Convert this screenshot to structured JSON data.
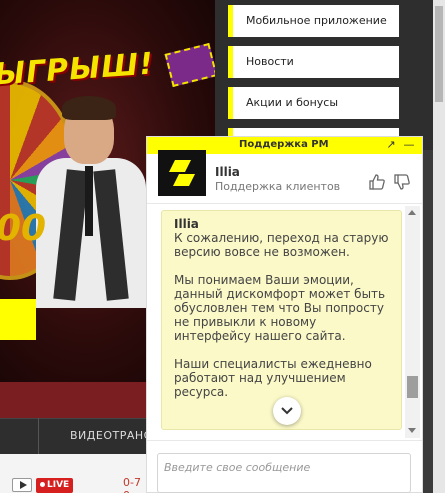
{
  "promo": {
    "headline": "ЫГРЫШ!",
    "neon_number": "00",
    "bottom_video_label": "ВИДЕОТРАНСЛ"
  },
  "match": {
    "live_badge": "LIVE",
    "score_a": "0-7",
    "score_b": "0"
  },
  "nav": {
    "items": [
      {
        "label": "Мобильное приложение"
      },
      {
        "label": "Новости"
      },
      {
        "label": "Акции и бонусы"
      }
    ]
  },
  "chat": {
    "title": "Поддержка РМ",
    "expand_glyph": "↗",
    "minimize_glyph": "—",
    "agent": {
      "name": "Illia",
      "role": "Поддержка клиентов"
    },
    "message": {
      "author": "Illia",
      "paragraphs": [
        "К сожалению, переход на старую версию вовсе не возможен.",
        "Мы понимаем Ваши эмоции, данный дискомфорт может быть обусловлен тем что Вы попросту не привыкли к новому интерфейсу нашего сайта.",
        "Наши специалисты ежедневно работают над улучшением ресурса."
      ]
    },
    "input_placeholder": "Введите свое сообщение"
  },
  "colors": {
    "accent_yellow": "#ffff00",
    "bubble_bg": "#fbf9c8",
    "live_red": "#d62020",
    "dark_bg": "#2e2e2e"
  },
  "icons": [
    "expand-icon",
    "minimize-icon",
    "thumbs-up-icon",
    "thumbs-down-icon",
    "chevron-down-icon",
    "play-icon",
    "brand-logo-icon"
  ]
}
